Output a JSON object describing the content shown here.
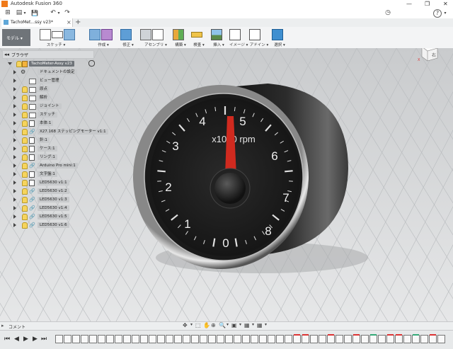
{
  "window": {
    "title": "Autodesk Fusion 360",
    "controls": [
      "—",
      "❐",
      "✕"
    ]
  },
  "quickbar": {
    "grid": "⊞",
    "file": "▤",
    "file_arrow": "▾",
    "save": "💾",
    "undo": "↶",
    "undo_arrow": "▾",
    "redo": "↷",
    "clock": "◷",
    "help": "?",
    "help_arrow": "▾"
  },
  "tab": {
    "label": "TachoMet...ssy v23*",
    "close": "×",
    "add": "+"
  },
  "toolbar": {
    "mode_label": "モデル ▾",
    "groups": [
      "スケッチ ▾",
      "作成 ▾",
      "修正 ▾",
      "アセンブリ ▾",
      "構築 ▾",
      "検査 ▾",
      "挿入 ▾",
      "イメージ ▾",
      "アドイン ▾",
      "選択 ▾"
    ]
  },
  "viewcube": {
    "face": "右",
    "axis_x": "X",
    "axis_z": "Z"
  },
  "browser": {
    "title": "ブラウザ",
    "root": "TachoMeter-Assy v23",
    "items": [
      {
        "label": "ドキュメントの設定"
      },
      {
        "label": "ビュー管理"
      },
      {
        "label": "原点"
      },
      {
        "label": "解析"
      },
      {
        "label": "ジョイント"
      },
      {
        "label": "スケッチ"
      },
      {
        "label": "本体:1"
      },
      {
        "label": "X27.168 ステッピングモーター v1:1"
      },
      {
        "label": "針:1"
      },
      {
        "label": "ケース:1"
      },
      {
        "label": "リング:1"
      },
      {
        "label": "Arduino Pro mini:1"
      },
      {
        "label": "文字盤:1"
      },
      {
        "label": "LED5630 v1:1"
      },
      {
        "label": "LED5630 v1:2"
      },
      {
        "label": "LED5630 v1:3"
      },
      {
        "label": "LED5630 v1:4"
      },
      {
        "label": "LED5630 v1:5"
      },
      {
        "label": "LED5630 v1:6"
      }
    ]
  },
  "gauge": {
    "numbers": [
      "0",
      "1",
      "2",
      "3",
      "4",
      "5",
      "6",
      "7",
      "8"
    ],
    "unit": "x1000 rpm",
    "needle_color": "#d02a1f"
  },
  "comments": {
    "label": "コメント"
  },
  "navbar": {
    "icons": [
      "✥",
      "▾",
      "⬚",
      "✋",
      "⊕",
      "🔍",
      "▾",
      "▣",
      "▾",
      "▦",
      "▾",
      "▦",
      "▾"
    ]
  },
  "timeline": {
    "controls": [
      "⏮",
      "◀",
      "▶",
      "▶",
      "⏭"
    ]
  }
}
